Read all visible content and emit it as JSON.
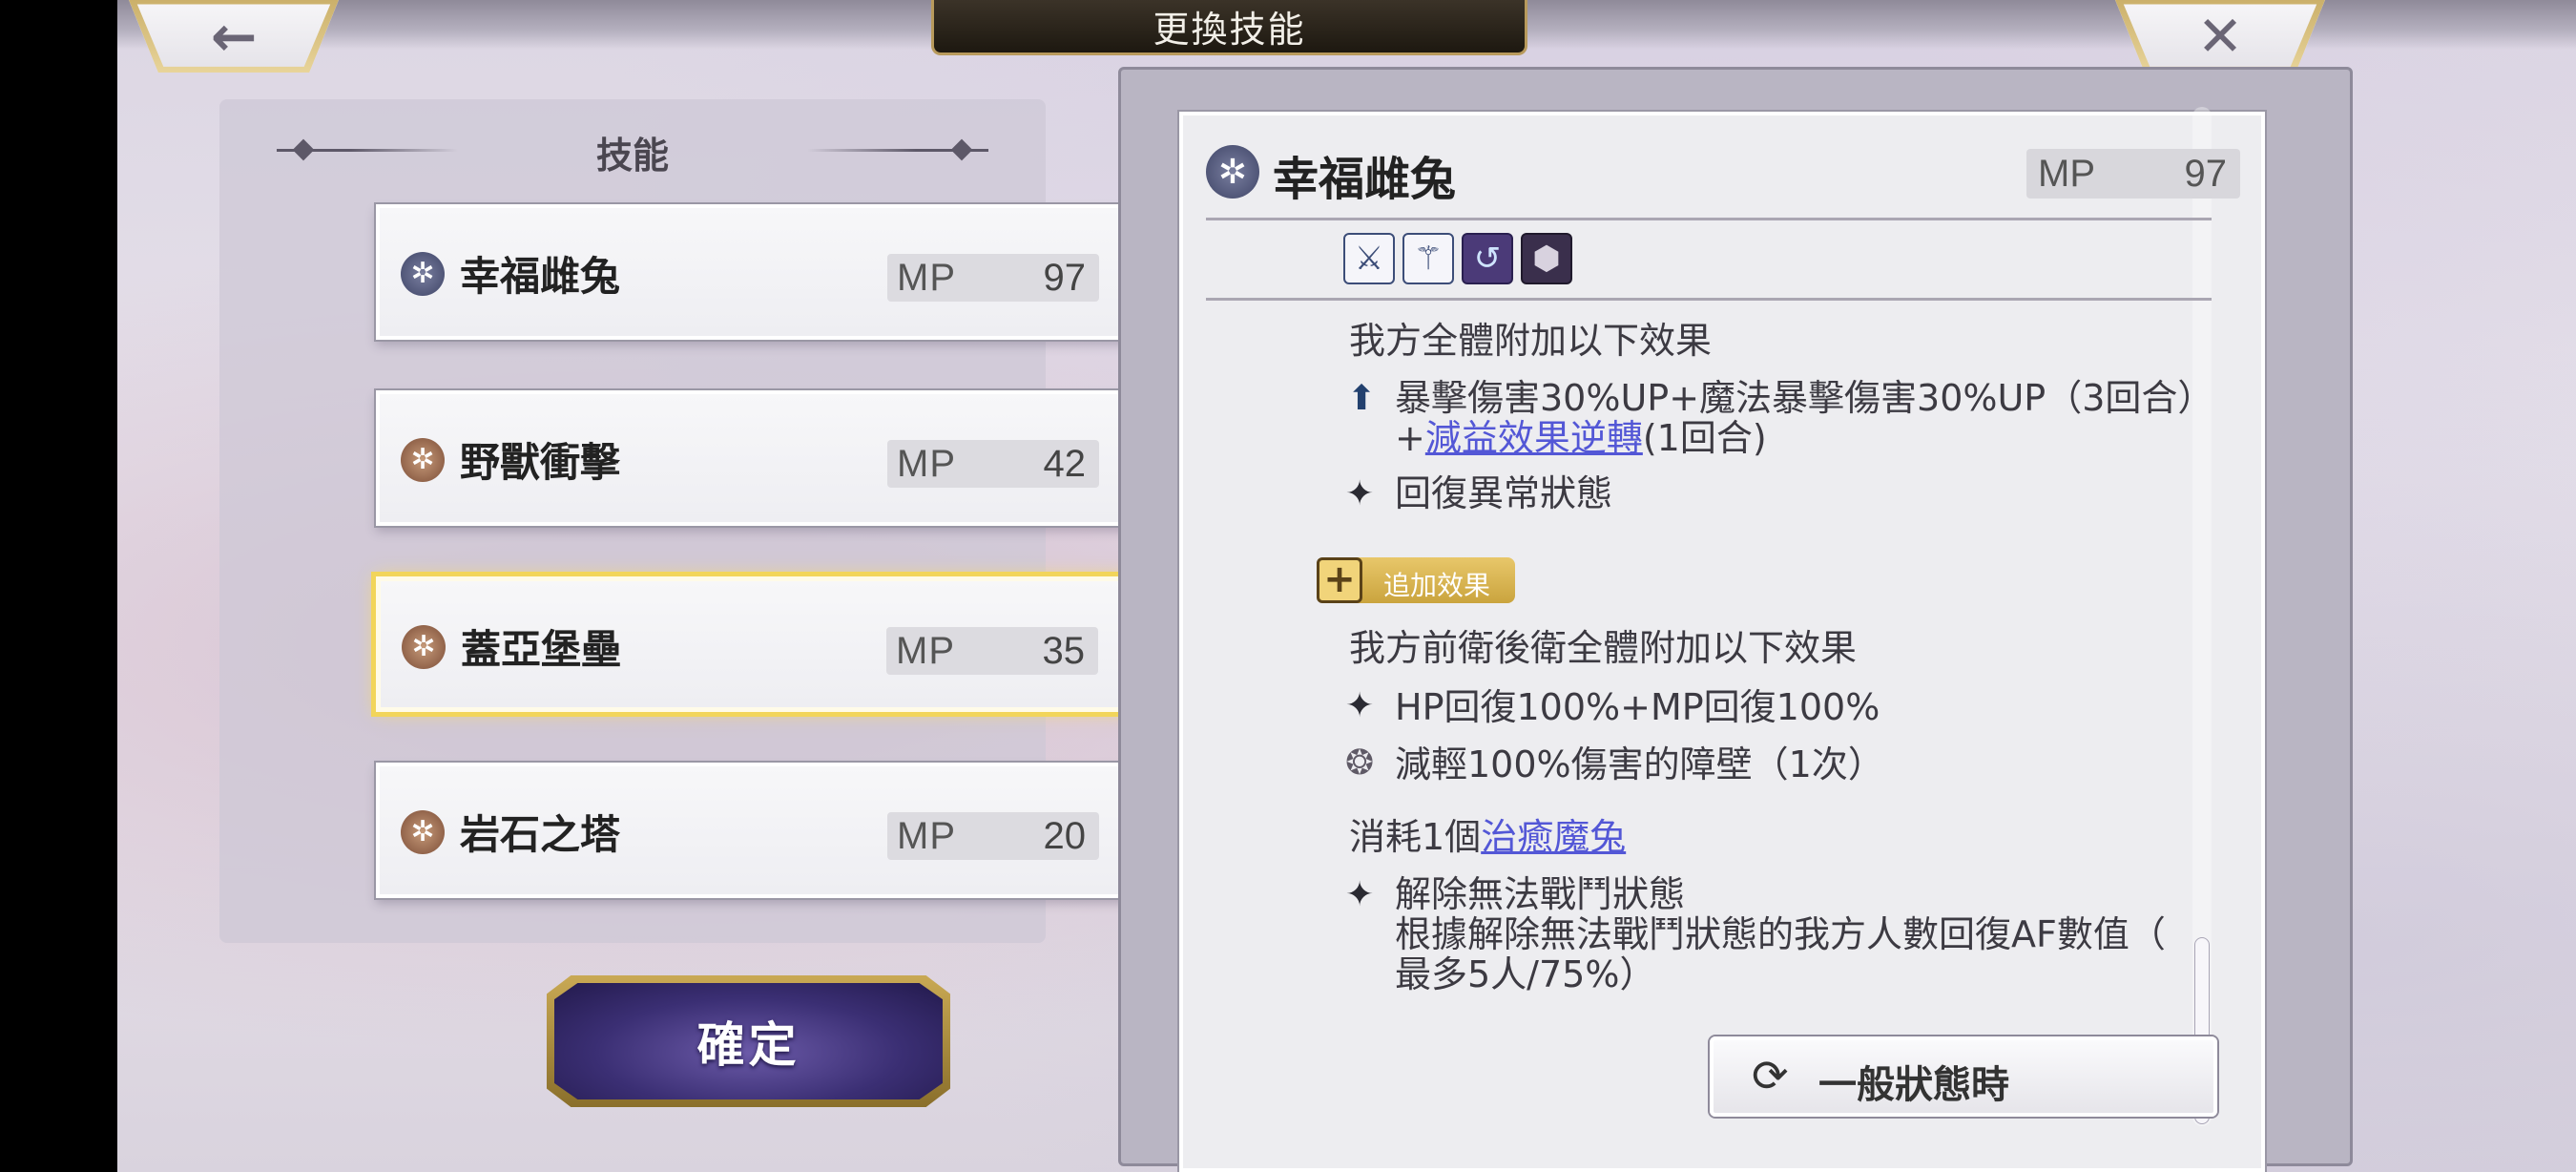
{
  "header": {
    "title": "更換技能",
    "back_icon": "←",
    "close_icon": "✕"
  },
  "skills_panel": {
    "title": "技能",
    "items": [
      {
        "name": "幸福雌兔",
        "mp_label": "MP",
        "mp": "97",
        "icon_color": "blue",
        "selected": false
      },
      {
        "name": "野獸衝擊",
        "mp_label": "MP",
        "mp": "42",
        "icon_color": "brown",
        "selected": false
      },
      {
        "name": "蓋亞堡壘",
        "mp_label": "MP",
        "mp": "35",
        "icon_color": "brown",
        "selected": true
      },
      {
        "name": "岩石之塔",
        "mp_label": "MP",
        "mp": "20",
        "icon_color": "brown",
        "selected": false
      }
    ]
  },
  "confirm_label": "確定",
  "detail": {
    "name": "幸福雌兔",
    "mp_label": "MP",
    "mp": "97",
    "tag_icons": [
      "crit-up-icon",
      "magic-crit-up-icon",
      "debuff-reverse-icon",
      "barrier-icon"
    ],
    "effect_intro": "我方全體附加以下效果",
    "effect1_line1": "暴擊傷害30%UP+魔法暴擊傷害30%UP（3回合）",
    "effect1_line2_prefix": "+",
    "effect1_link": "減益效果逆轉",
    "effect1_line2_suffix": "(1回合)",
    "effect2": "回復異常狀態",
    "extra_badge_label": "追加效果",
    "extra_intro": "我方前衛後衛全體附加以下效果",
    "extra1": "HP回復100%+MP回復100%",
    "extra2": "減輕100%傷害的障壁（1次）",
    "consume_prefix": "消耗1個",
    "consume_link": "治癒魔兔",
    "revive1": "解除無法戰鬥狀態",
    "revive2": "根據解除無法戰鬥狀態的我方人數回復AF數值（",
    "revive3": "最多5人/75%）",
    "normal_state_label": "一般狀態時",
    "normal_state_icon": "⟳"
  },
  "colors": {
    "selected_glow": "#f2d55a",
    "link": "#5357d6",
    "badge_gold": "#caa43e",
    "confirm_purple": "#3b2f74"
  }
}
